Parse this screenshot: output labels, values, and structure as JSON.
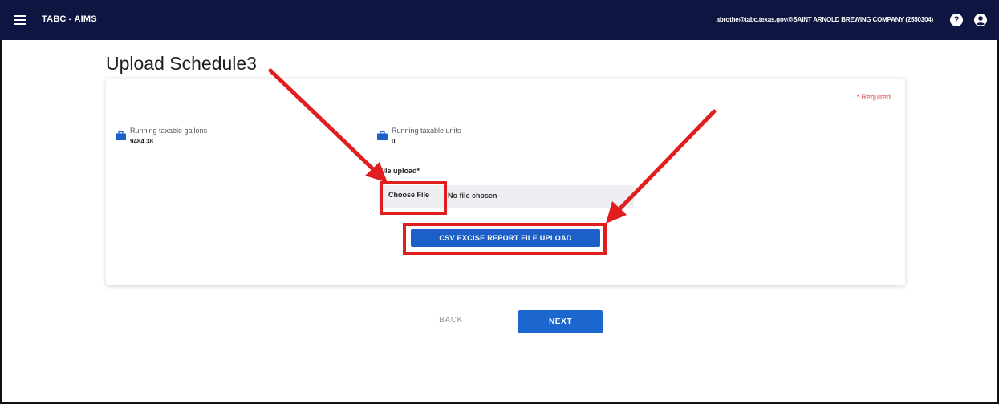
{
  "header": {
    "app_title": "TABC - AIMS",
    "user": "abrothe@tabc.texas.gov@SAINT ARNOLD BREWING COMPANY (2550304)",
    "help_glyph": "?",
    "icons": [
      "hamburger-menu-icon",
      "help-icon",
      "account-icon"
    ]
  },
  "page": {
    "title": "Upload Schedule3"
  },
  "form": {
    "required_note": "* Required",
    "stats": [
      {
        "label": "Running taxable gallons",
        "value": "9484.38",
        "icon": "briefcase-icon"
      },
      {
        "label": "Running taxable units",
        "value": "0",
        "icon": "briefcase-icon"
      }
    ],
    "file_upload_label": "File upload*",
    "choose_file_label": "Choose File",
    "no_file_text": "No file chosen",
    "csv_upload_button": "CSV EXCISE REPORT FILE UPLOAD"
  },
  "nav": {
    "back_label": "BACK",
    "next_label": "NEXT"
  },
  "annotations": {
    "color": "#e01e1e"
  },
  "colors": {
    "header_bg": "#0d1540",
    "primary": "#1c5fc9",
    "required": "#e24b4b"
  }
}
